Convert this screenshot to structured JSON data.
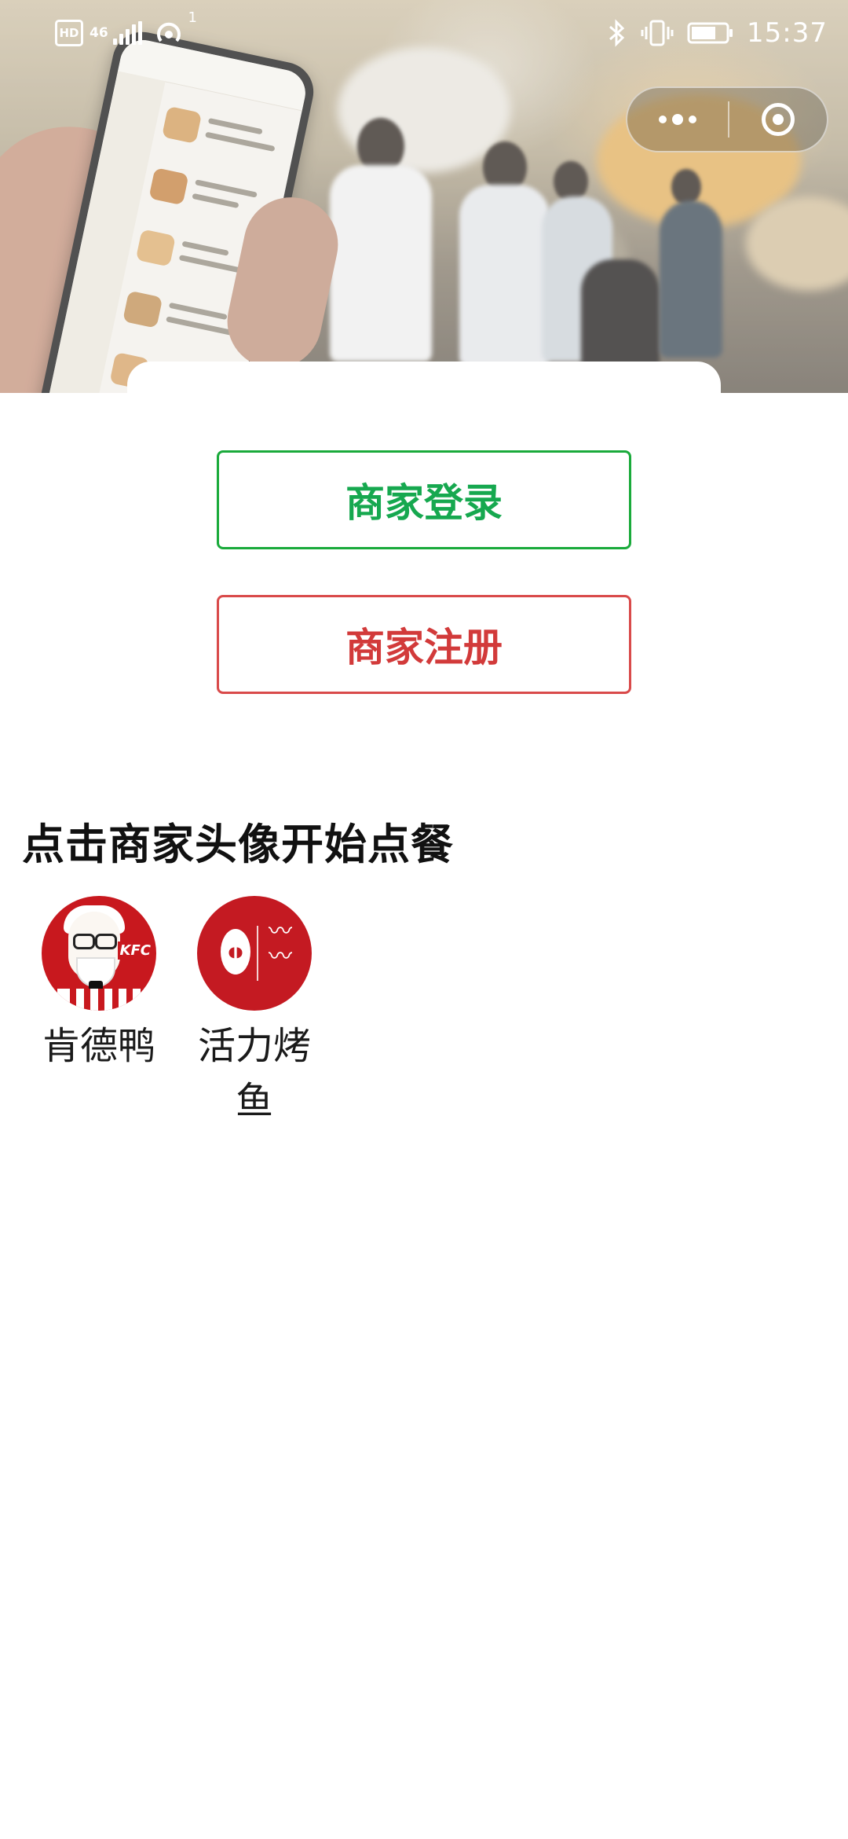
{
  "status_bar": {
    "hd": "HD",
    "network": "46",
    "hotspot_count": "1",
    "time": "15:37",
    "icons": [
      "hd-icon",
      "signal-icon",
      "hotspot-icon",
      "bluetooth-icon",
      "vibrate-icon",
      "battery-icon"
    ]
  },
  "capsule": {
    "more_icon": "more-dots-icon",
    "close_icon": "target-circle-icon"
  },
  "actions": {
    "login_label": "商家登录",
    "register_label": "商家注册",
    "login_color": "#16a84f",
    "register_color": "#d23a3a"
  },
  "merchants_section": {
    "title": "点击商家头像开始点餐",
    "merchants": [
      {
        "name": "肯德鸭",
        "avatar_logo_text": "KFC",
        "avatar_color": "#c8181e"
      },
      {
        "name": "活力烤鱼",
        "name_line1": "活力烤",
        "name_line2": "鱼",
        "avatar_color": "#c41a22"
      }
    ]
  }
}
